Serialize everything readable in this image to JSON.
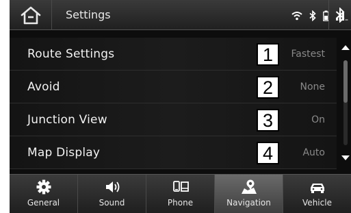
{
  "header": {
    "title": "Settings",
    "icons": [
      "home-icon",
      "wifi-icon",
      "bluetooth-icon",
      "battery-icon",
      "signal-icon",
      "bluetooth-icon"
    ]
  },
  "list": [
    {
      "label": "Route Settings",
      "value": "Fastest",
      "callout": "1"
    },
    {
      "label": "Avoid",
      "value": "None",
      "callout": "2"
    },
    {
      "label": "Junction View",
      "value": "On",
      "callout": "3"
    },
    {
      "label": "Map Display",
      "value": "Auto",
      "callout": "4"
    }
  ],
  "tabs": [
    {
      "label": "General",
      "icon": "gear-icon",
      "active": false
    },
    {
      "label": "Sound",
      "icon": "speaker-icon",
      "active": false
    },
    {
      "label": "Phone",
      "icon": "phone-icon",
      "active": false
    },
    {
      "label": "Navigation",
      "icon": "navigation-icon",
      "active": true
    },
    {
      "label": "Vehicle",
      "icon": "car-icon",
      "active": false
    }
  ],
  "colors": {
    "background": "#0d0d0d",
    "text": "#f2f2f2",
    "value_text": "#8a8a8a",
    "active_tab": "#5a5a5a"
  }
}
